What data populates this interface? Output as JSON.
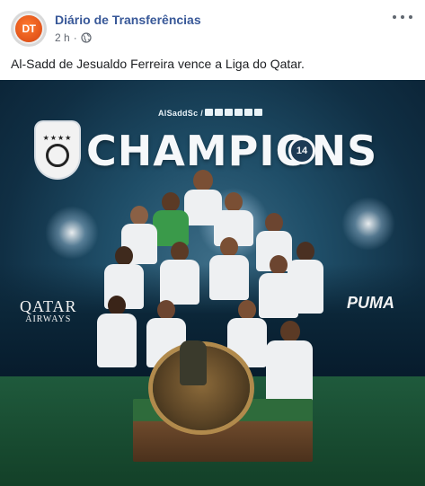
{
  "post": {
    "page_name": "Diário de Transferências",
    "avatar_text": "DT",
    "timestamp": "2 h",
    "separator": "·",
    "privacy_icon": "globe-icon",
    "more_icon": "more-options-icon",
    "caption": "Al-Sadd de Jesualdo Ferreira vence a Liga do Qatar."
  },
  "image": {
    "social_handle": "AlSaddSc /",
    "headline": "CHAMPIONS",
    "title_count": "14",
    "sponsor_left_line1": "QATAR",
    "sponsor_left_line2": "AIRWAYS",
    "sponsor_right": "PUMA",
    "colors": {
      "background": "#1f4e68",
      "headline": "#f6f8fa",
      "link": "#385898"
    }
  }
}
